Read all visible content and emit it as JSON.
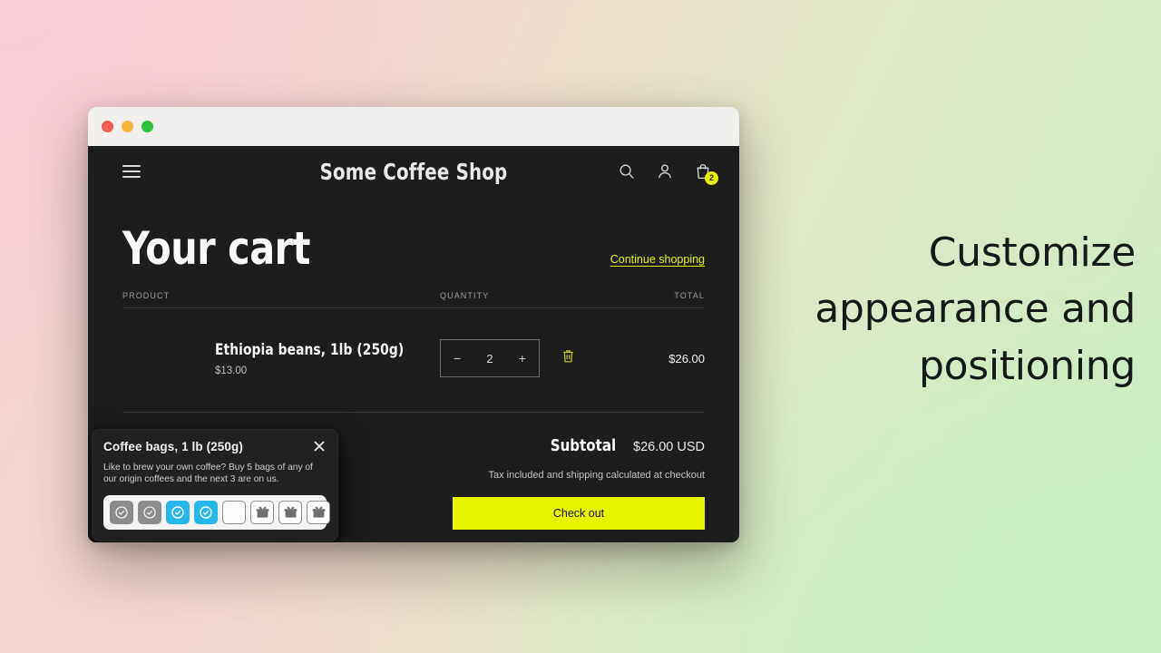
{
  "caption": {
    "text": "Customize appearance and positioning"
  },
  "window": {
    "traffic_lights": [
      {
        "name": "close",
        "color": "#f05b53"
      },
      {
        "name": "minimize",
        "color": "#f2b33d"
      },
      {
        "name": "zoom",
        "color": "#30c141"
      }
    ]
  },
  "shop_header": {
    "menu_icon": "hamburger-icon",
    "title": "Some Coffee Shop",
    "icons": [
      {
        "name": "search-icon"
      },
      {
        "name": "account-icon"
      },
      {
        "name": "cart-icon"
      }
    ],
    "cart_badge": "2"
  },
  "cart": {
    "title": "Your cart",
    "continue_link": "Continue shopping",
    "columns": {
      "product": "PRODUCT",
      "quantity": "QUANTITY",
      "total": "TOTAL"
    },
    "items": [
      {
        "name": "Ethiopia beans, 1lb (250g)",
        "unit_price": "$13.00",
        "quantity": "2",
        "decrease_label": "−",
        "increase_label": "+",
        "remove_icon": "trash-icon",
        "line_total": "$26.00"
      }
    ]
  },
  "totals": {
    "subtotal_label": "Subtotal",
    "subtotal_value": "$26.00 USD",
    "tax_note": "Tax included and shipping calculated at checkout",
    "checkout_label": "Check out"
  },
  "popup": {
    "title": "Coffee bags, 1 lb (250g)",
    "description": "Like to brew your own coffee? Buy 5 bags of any of our origin coffees and the next 3 are on us.",
    "close_icon": "close-icon",
    "tiles": [
      {
        "state": "done",
        "icon": "check-circle-icon"
      },
      {
        "state": "done",
        "icon": "check-circle-icon"
      },
      {
        "state": "active",
        "icon": "check-circle-icon"
      },
      {
        "state": "active",
        "icon": "check-circle-icon"
      },
      {
        "state": "next",
        "icon": "empty-icon"
      },
      {
        "state": "gift",
        "icon": "gift-icon"
      },
      {
        "state": "gift",
        "icon": "gift-icon"
      },
      {
        "state": "gift",
        "icon": "gift-icon"
      }
    ]
  },
  "colors": {
    "accent_yellow": "#e6f500",
    "accent_cyan": "#29b6e8",
    "surface_dark": "#1d1d1d",
    "popup_bg": "#212121"
  }
}
